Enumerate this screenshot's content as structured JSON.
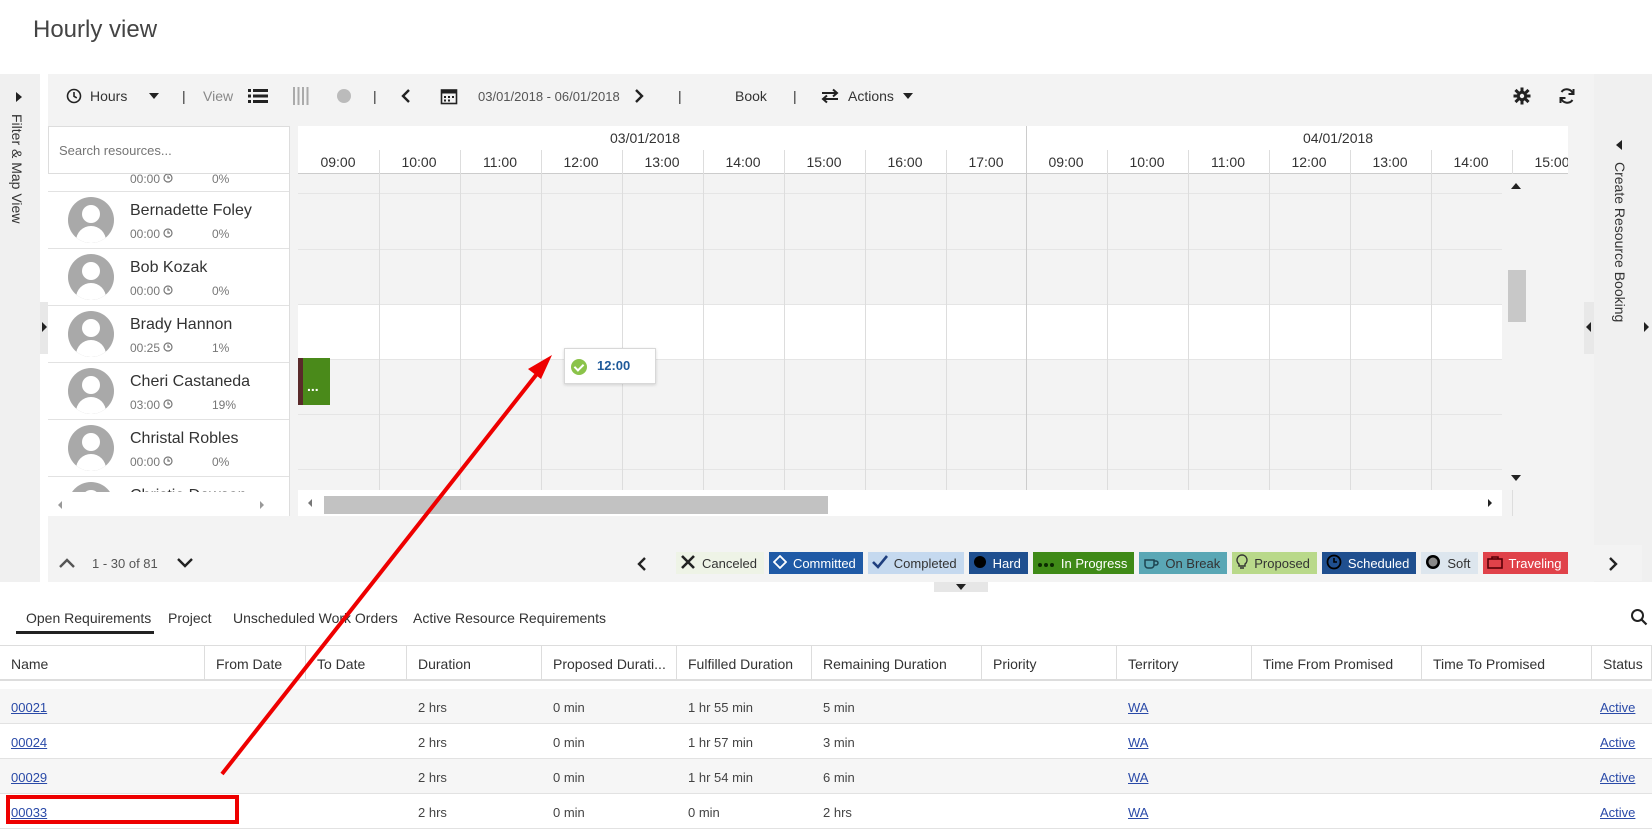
{
  "page": {
    "title": "Hourly view"
  },
  "left_panel": {
    "label": "Filter & Map View"
  },
  "right_panel": {
    "label": "Create Resource Booking"
  },
  "toolbar": {
    "hours_label": "Hours",
    "view_label": "View",
    "date_range": "03/01/2018 - 06/01/2018",
    "book_label": "Book",
    "actions_label": "Actions"
  },
  "resources": {
    "search_placeholder": "Search resources...",
    "partial_top": {
      "time": "00:00",
      "pct": "0%"
    },
    "items": [
      {
        "name": "Bernadette Foley",
        "time": "00:00",
        "pct": "0%"
      },
      {
        "name": "Bob Kozak",
        "time": "00:00",
        "pct": "0%"
      },
      {
        "name": "Brady Hannon",
        "time": "00:25",
        "pct": "1%"
      },
      {
        "name": "Cheri Castaneda",
        "time": "03:00",
        "pct": "19%"
      },
      {
        "name": "Christal Robles",
        "time": "00:00",
        "pct": "0%"
      },
      {
        "name": "Christie Dawson",
        "time": "",
        "pct": ""
      }
    ]
  },
  "timeline": {
    "dates": [
      "03/01/2018",
      "04/01/2018"
    ],
    "hours_day1": [
      "09:00",
      "10:00",
      "11:00",
      "12:00",
      "13:00",
      "14:00",
      "15:00",
      "16:00",
      "17:00"
    ],
    "hours_day2": [
      "09:00",
      "10:00",
      "11:00",
      "12:00",
      "13:00",
      "14:00",
      "15:00"
    ],
    "booking_label": "...",
    "tooltip_time": "12:00"
  },
  "pager": {
    "text": "1 - 30 of 81"
  },
  "legend": [
    {
      "label": "Canceled",
      "color": "#eef3e6",
      "text": "#333"
    },
    {
      "label": "Committed",
      "color": "#1f5aa6",
      "text": "#fff"
    },
    {
      "label": "Completed",
      "color": "#c5d9ef",
      "text": "#333"
    },
    {
      "label": "Hard",
      "color": "#1f4f8f",
      "text": "#fff"
    },
    {
      "label": "In Progress",
      "color": "#3f8a17",
      "text": "#fff"
    },
    {
      "label": "On Break",
      "color": "#5aa7b5",
      "text": "#333"
    },
    {
      "label": "Proposed",
      "color": "#b9d98a",
      "text": "#333"
    },
    {
      "label": "Scheduled",
      "color": "#1f4f8f",
      "text": "#fff"
    },
    {
      "label": "Soft",
      "color": "#dde6ee",
      "text": "#333"
    },
    {
      "label": "Traveling",
      "color": "#e0424a",
      "text": "#fff"
    }
  ],
  "tabs": [
    "Open Requirements",
    "Project",
    "Unscheduled Work Orders",
    "Active Resource Requirements"
  ],
  "grid": {
    "columns": [
      "Name",
      "From Date",
      "To Date",
      "Duration",
      "Proposed Durati...",
      "Fulfilled Duration",
      "Remaining Duration",
      "Priority",
      "Territory",
      "Time From Promised",
      "Time To Promised",
      "Status"
    ],
    "rows": [
      {
        "name": "00021",
        "duration": "2 hrs",
        "proposed": "0 min",
        "fulfilled": "1 hr 55 min",
        "remaining": "5 min",
        "territory": "WA",
        "status": "Active"
      },
      {
        "name": "00024",
        "duration": "2 hrs",
        "proposed": "0 min",
        "fulfilled": "1 hr 57 min",
        "remaining": "3 min",
        "territory": "WA",
        "status": "Active"
      },
      {
        "name": "00029",
        "duration": "2 hrs",
        "proposed": "0 min",
        "fulfilled": "1 hr 54 min",
        "remaining": "6 min",
        "territory": "WA",
        "status": "Active"
      },
      {
        "name": "00033",
        "duration": "2 hrs",
        "proposed": "0 min",
        "fulfilled": "0 min",
        "remaining": "2 hrs",
        "territory": "WA",
        "status": "Active"
      }
    ]
  }
}
